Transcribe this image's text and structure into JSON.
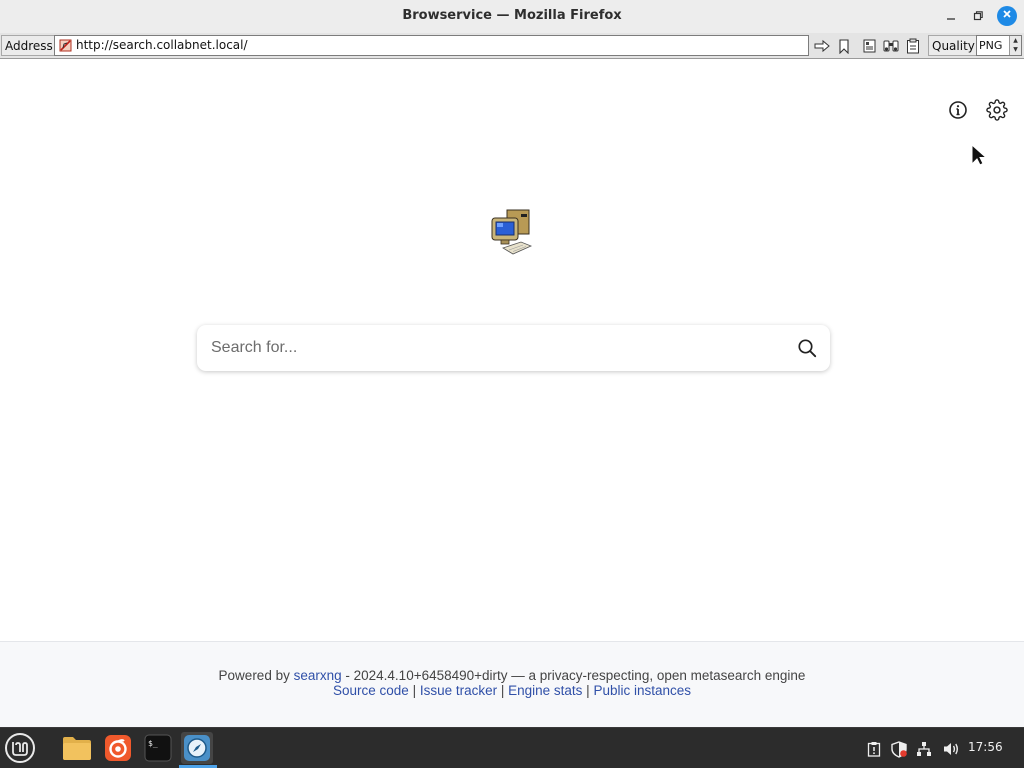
{
  "window": {
    "title": "Browservice — Mozilla Firefox"
  },
  "toolbar": {
    "address_label": "Address",
    "url": "http://search.collabnet.local/",
    "quality_label": "Quality",
    "format_value": "PNG"
  },
  "page": {
    "search": {
      "placeholder": "Search for..."
    },
    "footer": {
      "powered_by": "Powered by",
      "engine_name": "searxng",
      "version_text": " - 2024.4.10+6458490+dirty — a privacy-respecting, open metasearch engine",
      "links": [
        "Source code",
        "Issue tracker",
        "Engine stats",
        "Public instances"
      ],
      "separator": " | "
    }
  },
  "taskbar": {
    "clock": "17:56"
  },
  "colors": {
    "link": "#3050a8",
    "window_close": "#1e8ae6",
    "taskbar_bg": "#2c2c2c",
    "active_indicator": "#4da2e8"
  }
}
